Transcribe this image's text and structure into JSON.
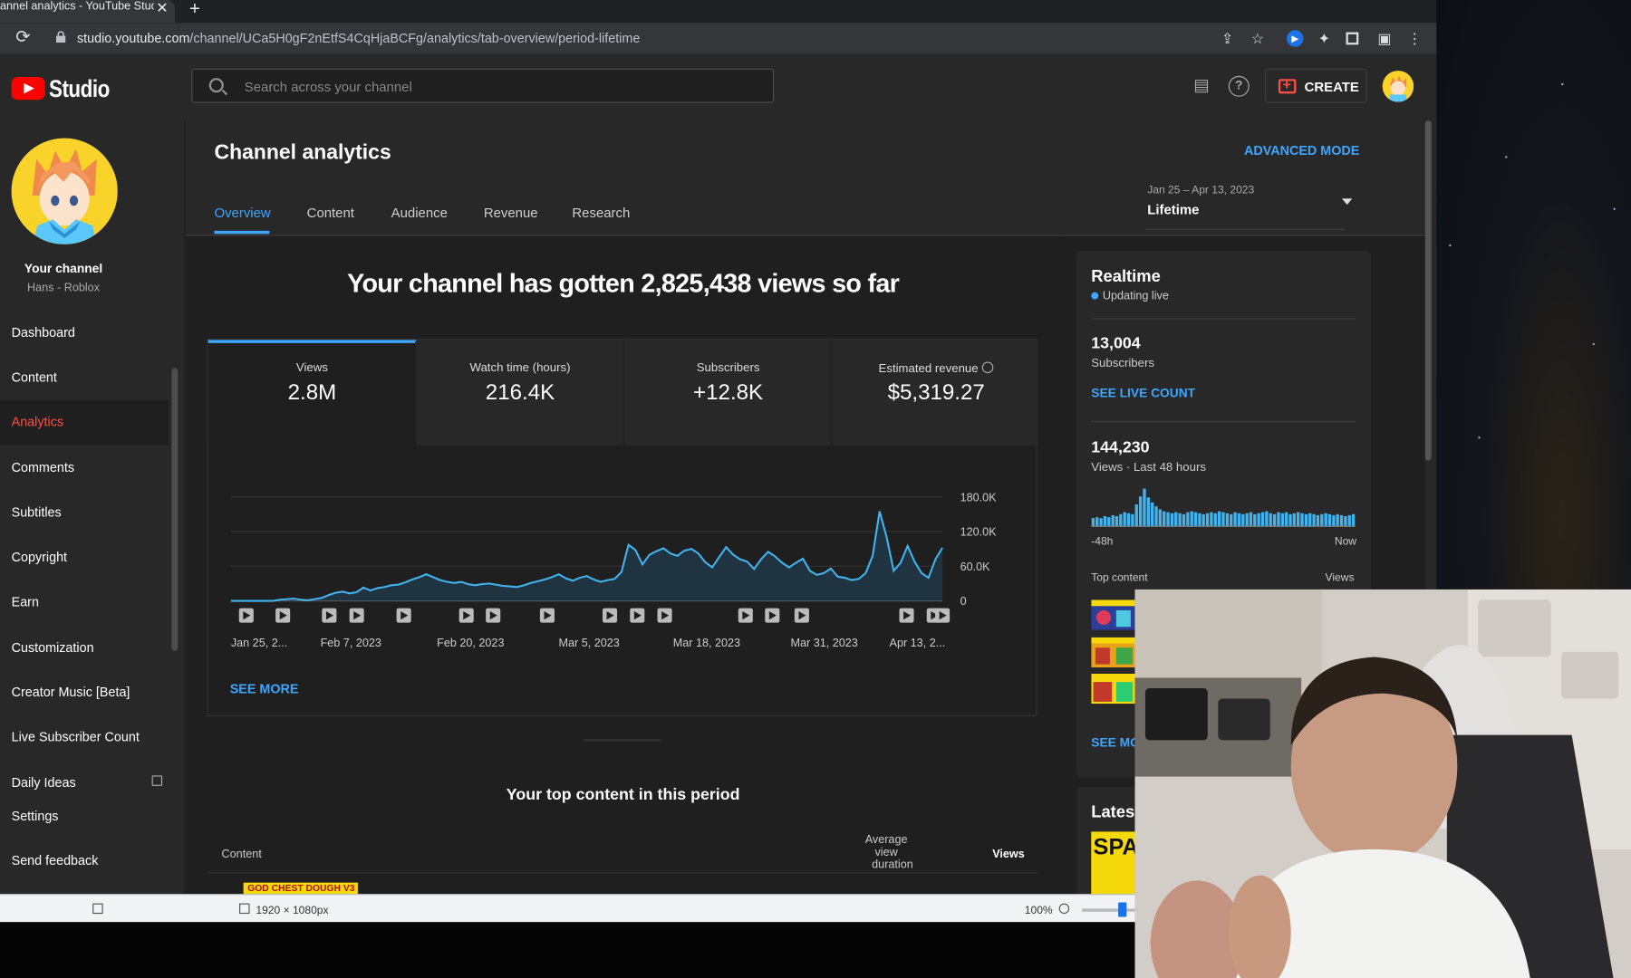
{
  "browser": {
    "tab_title": "annel analytics - YouTube Studio",
    "tab_close": "✕",
    "new_tab": "+",
    "url_host": "studio.youtube.com",
    "url_path": "/channel/UCa5H0gF2nEtfS4CqHjaBCFg/analytics/tab-overview/period-lifetime"
  },
  "header": {
    "logo_text": "Studio",
    "search_placeholder": "Search across your channel",
    "create_label": "CREATE"
  },
  "sidebar": {
    "your_channel": "Your channel",
    "channel_name": "Hans - Roblox",
    "items": [
      {
        "label": "Dashboard"
      },
      {
        "label": "Content"
      },
      {
        "label": "Analytics"
      },
      {
        "label": "Comments"
      },
      {
        "label": "Subtitles"
      },
      {
        "label": "Copyright"
      },
      {
        "label": "Earn"
      },
      {
        "label": "Customization"
      },
      {
        "label": "Creator Music [Beta]"
      },
      {
        "label": "Live Subscriber Count"
      },
      {
        "label": "Daily Ideas"
      },
      {
        "label": "Settings"
      },
      {
        "label": "Send feedback"
      }
    ],
    "active_index": 2
  },
  "main": {
    "title": "Channel analytics",
    "advanced_mode": "ADVANCED MODE",
    "tabs": [
      {
        "label": "Overview"
      },
      {
        "label": "Content"
      },
      {
        "label": "Audience"
      },
      {
        "label": "Revenue"
      },
      {
        "label": "Research"
      }
    ],
    "date_range": "Jan 25 – Apr 13, 2023",
    "date_label": "Lifetime",
    "headline": "Your channel has gotten 2,825,438 views so far",
    "metrics": [
      {
        "label": "Views",
        "value": "2.8M"
      },
      {
        "label": "Watch time (hours)",
        "value": "216.4K"
      },
      {
        "label": "Subscribers",
        "value": "+12.8K"
      },
      {
        "label": "Estimated revenue",
        "value": "$5,319.27"
      }
    ],
    "see_more": "SEE MORE",
    "top_content_title": "Your top content in this period",
    "columns": {
      "content": "Content",
      "avg_view_1": "Average view",
      "avg_view_2": "duration",
      "views": "Views"
    },
    "first_row_thumb_text": "GOD CHEST DOUGH V3"
  },
  "chart_data": {
    "type": "area",
    "series": [
      {
        "values": [
          0,
          0,
          0,
          0,
          0,
          0,
          0,
          2,
          3,
          4,
          2,
          1,
          3,
          5,
          10,
          14,
          16,
          13,
          15,
          23,
          18,
          22,
          24,
          27,
          28,
          32,
          37,
          41,
          46,
          41,
          36,
          33,
          31,
          33,
          29,
          27,
          29,
          30,
          28,
          26,
          25,
          24,
          27,
          31,
          34,
          37,
          41,
          46,
          39,
          35,
          40,
          43,
          37,
          33,
          36,
          38,
          50,
          97,
          88,
          63,
          80,
          86,
          91,
          82,
          78,
          87,
          90,
          82,
          67,
          58,
          76,
          93,
          80,
          72,
          68,
          55,
          72,
          85,
          77,
          66,
          58,
          66,
          73,
          52,
          45,
          48,
          56,
          42,
          40,
          36,
          38,
          48,
          78,
          155,
          110,
          52,
          66,
          95,
          68,
          48,
          40,
          72,
          92
        ]
      }
    ],
    "x_tick_labels": [
      "Jan 25, 2...",
      "Feb 7, 2023",
      "Feb 20, 2023",
      "Mar 5, 2023",
      "Mar 18, 2023",
      "Mar 31, 2023",
      "Apr 13, 2..."
    ],
    "y_tick_labels": [
      "180.0K",
      "120.0K",
      "60.0K",
      "0"
    ],
    "ylim": [
      0,
      180
    ],
    "y_units": "thousand views",
    "video_marker_positions": [
      0.01,
      0.062,
      0.128,
      0.167,
      0.234,
      0.323,
      0.361,
      0.438,
      0.527,
      0.566,
      0.605,
      0.72,
      0.758,
      0.8,
      0.949,
      0.988,
      1.0
    ],
    "grid": true,
    "legend": "none"
  },
  "realtime": {
    "title": "Realtime",
    "updating": "Updating live",
    "subscribers_value": "13,004",
    "subscribers_label": "Subscribers",
    "see_live_count": "SEE LIVE COUNT",
    "views_value": "144,230",
    "views_label": "Views · Last 48 hours",
    "axis_left": "-48h",
    "axis_right": "Now",
    "top_content": "Top content",
    "top_views": "Views",
    "see_more": "SEE MORE",
    "bars": [
      8,
      9,
      8,
      10,
      9,
      11,
      10,
      12,
      14,
      13,
      12,
      22,
      30,
      38,
      29,
      24,
      20,
      17,
      15,
      14,
      13,
      14,
      13,
      12,
      14,
      15,
      14,
      13,
      12,
      13,
      14,
      13,
      15,
      14,
      13,
      12,
      14,
      13,
      12,
      13,
      14,
      12,
      13,
      14,
      15,
      13,
      12,
      14,
      13,
      14,
      12,
      13,
      14,
      13,
      12,
      13,
      12,
      11,
      12,
      13,
      12,
      11,
      12,
      11,
      10,
      11,
      12
    ]
  },
  "latest": {
    "title": "Latest",
    "thumb_text": "SPAC"
  },
  "devtools": {
    "size": "1920 × 1080px",
    "zoom": "100%"
  }
}
